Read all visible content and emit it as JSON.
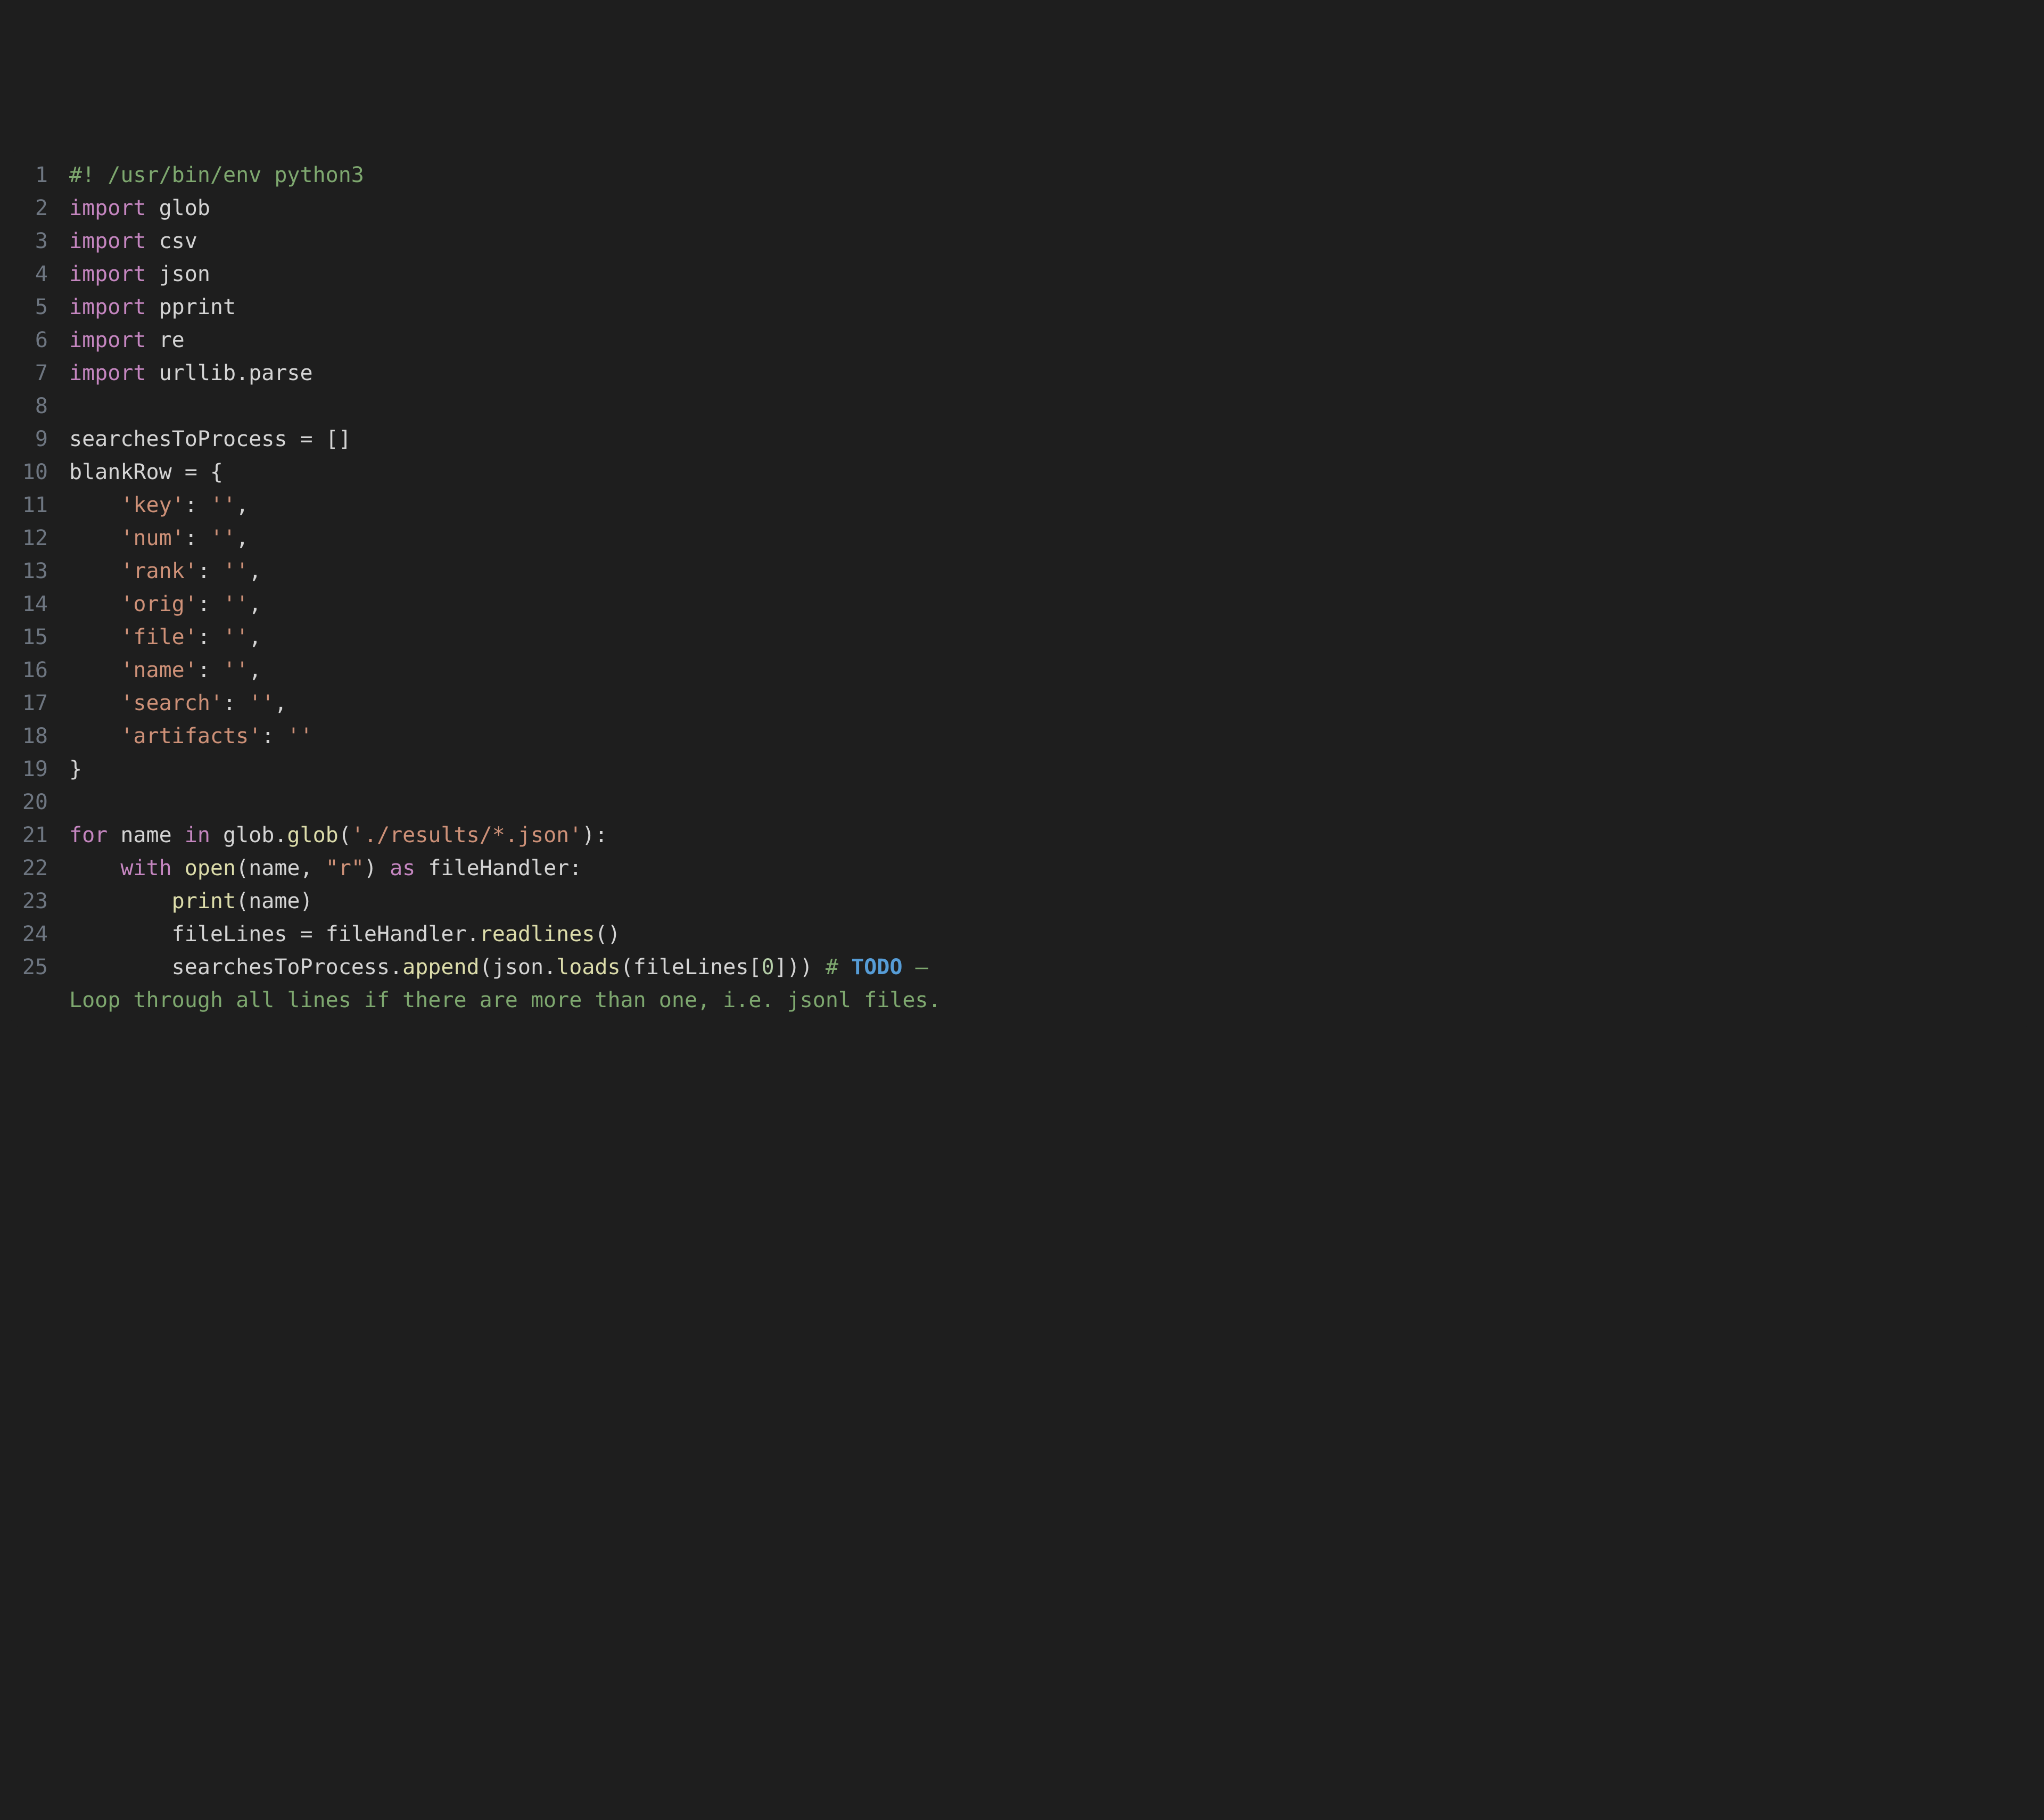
{
  "code": {
    "lines": [
      {
        "n": 1,
        "tokens": [
          {
            "t": "#! /usr/bin/env python3",
            "c": "tk-comment"
          }
        ]
      },
      {
        "n": 2,
        "tokens": [
          {
            "t": "import",
            "c": "tk-keyword"
          },
          {
            "t": " glob",
            "c": "tk-ident"
          }
        ]
      },
      {
        "n": 3,
        "tokens": [
          {
            "t": "import",
            "c": "tk-keyword"
          },
          {
            "t": " csv",
            "c": "tk-ident"
          }
        ]
      },
      {
        "n": 4,
        "tokens": [
          {
            "t": "import",
            "c": "tk-keyword"
          },
          {
            "t": " json",
            "c": "tk-ident"
          }
        ]
      },
      {
        "n": 5,
        "tokens": [
          {
            "t": "import",
            "c": "tk-keyword"
          },
          {
            "t": " pprint",
            "c": "tk-ident"
          }
        ]
      },
      {
        "n": 6,
        "tokens": [
          {
            "t": "import",
            "c": "tk-keyword"
          },
          {
            "t": " re",
            "c": "tk-ident"
          }
        ]
      },
      {
        "n": 7,
        "tokens": [
          {
            "t": "import",
            "c": "tk-keyword"
          },
          {
            "t": " urllib.parse",
            "c": "tk-ident"
          }
        ]
      },
      {
        "n": 8,
        "tokens": [
          {
            "t": "",
            "c": "tk-ident"
          }
        ]
      },
      {
        "n": 9,
        "tokens": [
          {
            "t": "searchesToProcess ",
            "c": "tk-ident"
          },
          {
            "t": "=",
            "c": "tk-punct"
          },
          {
            "t": " []",
            "c": "tk-punct"
          }
        ]
      },
      {
        "n": 10,
        "tokens": [
          {
            "t": "blankRow ",
            "c": "tk-ident"
          },
          {
            "t": "=",
            "c": "tk-punct"
          },
          {
            "t": " {",
            "c": "tk-punct"
          }
        ]
      },
      {
        "n": 11,
        "tokens": [
          {
            "t": "    ",
            "c": "tk-ident"
          },
          {
            "t": "'key'",
            "c": "tk-string"
          },
          {
            "t": ": ",
            "c": "tk-punct"
          },
          {
            "t": "''",
            "c": "tk-string"
          },
          {
            "t": ",",
            "c": "tk-punct"
          }
        ]
      },
      {
        "n": 12,
        "tokens": [
          {
            "t": "    ",
            "c": "tk-ident"
          },
          {
            "t": "'num'",
            "c": "tk-string"
          },
          {
            "t": ": ",
            "c": "tk-punct"
          },
          {
            "t": "''",
            "c": "tk-string"
          },
          {
            "t": ",",
            "c": "tk-punct"
          }
        ]
      },
      {
        "n": 13,
        "tokens": [
          {
            "t": "    ",
            "c": "tk-ident"
          },
          {
            "t": "'rank'",
            "c": "tk-string"
          },
          {
            "t": ": ",
            "c": "tk-punct"
          },
          {
            "t": "''",
            "c": "tk-string"
          },
          {
            "t": ",",
            "c": "tk-punct"
          }
        ]
      },
      {
        "n": 14,
        "tokens": [
          {
            "t": "    ",
            "c": "tk-ident"
          },
          {
            "t": "'orig'",
            "c": "tk-string"
          },
          {
            "t": ": ",
            "c": "tk-punct"
          },
          {
            "t": "''",
            "c": "tk-string"
          },
          {
            "t": ",",
            "c": "tk-punct"
          }
        ]
      },
      {
        "n": 15,
        "tokens": [
          {
            "t": "    ",
            "c": "tk-ident"
          },
          {
            "t": "'file'",
            "c": "tk-string"
          },
          {
            "t": ": ",
            "c": "tk-punct"
          },
          {
            "t": "''",
            "c": "tk-string"
          },
          {
            "t": ",",
            "c": "tk-punct"
          }
        ]
      },
      {
        "n": 16,
        "tokens": [
          {
            "t": "    ",
            "c": "tk-ident"
          },
          {
            "t": "'name'",
            "c": "tk-string"
          },
          {
            "t": ": ",
            "c": "tk-punct"
          },
          {
            "t": "''",
            "c": "tk-string"
          },
          {
            "t": ",",
            "c": "tk-punct"
          }
        ]
      },
      {
        "n": 17,
        "tokens": [
          {
            "t": "    ",
            "c": "tk-ident"
          },
          {
            "t": "'search'",
            "c": "tk-string"
          },
          {
            "t": ": ",
            "c": "tk-punct"
          },
          {
            "t": "''",
            "c": "tk-string"
          },
          {
            "t": ",",
            "c": "tk-punct"
          }
        ]
      },
      {
        "n": 18,
        "tokens": [
          {
            "t": "    ",
            "c": "tk-ident"
          },
          {
            "t": "'artifacts'",
            "c": "tk-string"
          },
          {
            "t": ": ",
            "c": "tk-punct"
          },
          {
            "t": "''",
            "c": "tk-string"
          }
        ]
      },
      {
        "n": 19,
        "tokens": [
          {
            "t": "}",
            "c": "tk-punct"
          }
        ]
      },
      {
        "n": 20,
        "tokens": [
          {
            "t": "",
            "c": "tk-ident"
          }
        ]
      },
      {
        "n": 21,
        "tokens": [
          {
            "t": "for",
            "c": "tk-keyword"
          },
          {
            "t": " name ",
            "c": "tk-ident"
          },
          {
            "t": "in",
            "c": "tk-keyword"
          },
          {
            "t": " glob.",
            "c": "tk-ident"
          },
          {
            "t": "glob",
            "c": "tk-func"
          },
          {
            "t": "(",
            "c": "tk-punct"
          },
          {
            "t": "'./results/*.json'",
            "c": "tk-string"
          },
          {
            "t": "):",
            "c": "tk-punct"
          }
        ]
      },
      {
        "n": 22,
        "tokens": [
          {
            "t": "    ",
            "c": "tk-ident"
          },
          {
            "t": "with",
            "c": "tk-keyword"
          },
          {
            "t": " ",
            "c": "tk-ident"
          },
          {
            "t": "open",
            "c": "tk-builtin"
          },
          {
            "t": "(",
            "c": "tk-punct"
          },
          {
            "t": "name",
            "c": "tk-ident"
          },
          {
            "t": ", ",
            "c": "tk-punct"
          },
          {
            "t": "\"r\"",
            "c": "tk-string"
          },
          {
            "t": ") ",
            "c": "tk-punct"
          },
          {
            "t": "as",
            "c": "tk-keyword"
          },
          {
            "t": " fileHandler:",
            "c": "tk-ident"
          }
        ]
      },
      {
        "n": 23,
        "tokens": [
          {
            "t": "        ",
            "c": "tk-ident"
          },
          {
            "t": "print",
            "c": "tk-builtin"
          },
          {
            "t": "(",
            "c": "tk-punct"
          },
          {
            "t": "name",
            "c": "tk-ident"
          },
          {
            "t": ")",
            "c": "tk-punct"
          }
        ]
      },
      {
        "n": 24,
        "tokens": [
          {
            "t": "        fileLines ",
            "c": "tk-ident"
          },
          {
            "t": "=",
            "c": "tk-punct"
          },
          {
            "t": " fileHandler.",
            "c": "tk-ident"
          },
          {
            "t": "readlines",
            "c": "tk-func"
          },
          {
            "t": "()",
            "c": "tk-punct"
          }
        ]
      },
      {
        "n": 25,
        "tokens": [
          {
            "t": "        searchesToProcess.",
            "c": "tk-ident"
          },
          {
            "t": "append",
            "c": "tk-func"
          },
          {
            "t": "(",
            "c": "tk-punct"
          },
          {
            "t": "json.",
            "c": "tk-ident"
          },
          {
            "t": "loads",
            "c": "tk-func"
          },
          {
            "t": "(",
            "c": "tk-punct"
          },
          {
            "t": "fileLines[",
            "c": "tk-ident"
          },
          {
            "t": "0",
            "c": "tk-number"
          },
          {
            "t": "])) ",
            "c": "tk-punct"
          },
          {
            "t": "# ",
            "c": "tk-comment"
          },
          {
            "t": "TODO",
            "c": "tk-todo"
          },
          {
            "t": " – ",
            "c": "tk-comment"
          }
        ]
      },
      {
        "n": "",
        "cont": true,
        "tokens": [
          {
            "t": "Loop through all lines if there are more than one, i.e. jsonl files.",
            "c": "tk-comment"
          }
        ]
      }
    ]
  }
}
